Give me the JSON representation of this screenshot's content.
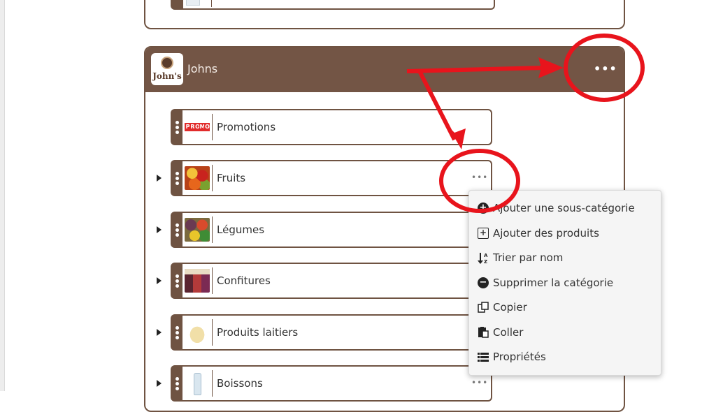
{
  "previous_card": {
    "icon": "bottle-icon"
  },
  "store": {
    "name": "Johns",
    "logo_text": "John's",
    "menu_icon": "ellipsis",
    "header_color": "#735545"
  },
  "categories": [
    {
      "label": "Promotions",
      "thumb": "promo",
      "has_children": false,
      "more": ""
    },
    {
      "label": "Fruits",
      "thumb": "fruits",
      "has_children": true,
      "more": "•••"
    },
    {
      "label": "Légumes",
      "thumb": "vegetables",
      "has_children": true,
      "more": ""
    },
    {
      "label": "Confitures",
      "thumb": "jams",
      "has_children": true,
      "more": ""
    },
    {
      "label": "Produits laitiers",
      "thumb": "dairy",
      "has_children": true,
      "more": ""
    },
    {
      "label": "Boissons",
      "thumb": "bottle",
      "has_children": true,
      "more": "•••"
    }
  ],
  "promo_letters": [
    "P",
    "R",
    "O",
    "M",
    "O"
  ],
  "context_menu": {
    "items": [
      {
        "label": "Ajouter une sous-catégorie",
        "icon": "plus-circle-icon"
      },
      {
        "label": "Ajouter des produits",
        "icon": "plus-square-icon"
      },
      {
        "label": "Trier par nom",
        "icon": "sort-az-icon"
      },
      {
        "label": "Supprimer la catégorie",
        "icon": "minus-circle-icon"
      },
      {
        "label": "Copier",
        "icon": "copy-icon"
      },
      {
        "label": "Coller",
        "icon": "paste-icon"
      },
      {
        "label": "Propriétés",
        "icon": "list-icon"
      }
    ]
  },
  "annotation_color": "#e8141c"
}
